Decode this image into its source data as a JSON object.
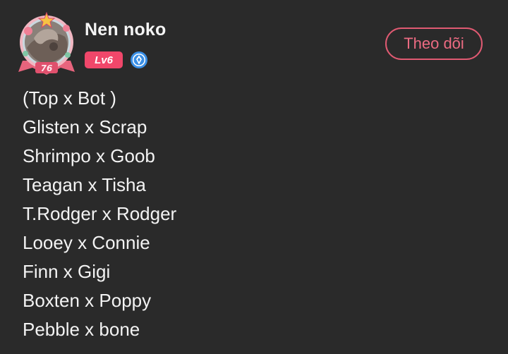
{
  "user": {
    "name": "Nen noko",
    "level": "Lv6",
    "frame_number": "76"
  },
  "actions": {
    "follow_label": "Theo dõi"
  },
  "post": {
    "lines": [
      "(Top x Bot )",
      "Glisten x Scrap",
      "Shrimpo x Goob",
      "Teagan x Tisha",
      "T.Rodger x Rodger",
      "Looey x Connie",
      "Finn x Gigi",
      "Boxten x Poppy",
      "Pebble x bone"
    ]
  },
  "colors": {
    "background": "#2a2a2a",
    "accent": "#f0476a",
    "follow_border": "#e05a72",
    "verified": "#3a8fe6"
  }
}
